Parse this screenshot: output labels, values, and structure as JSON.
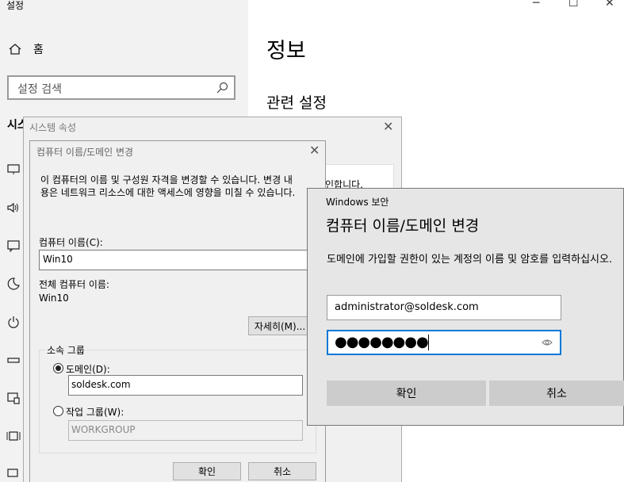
{
  "settings": {
    "window_title": "설정",
    "home_label": "홈",
    "search_placeholder": "설정 검색",
    "section_label": "시스",
    "page_title": "정보",
    "related_title": "관련 설정",
    "window_controls": [
      "─",
      "☐",
      "✕"
    ]
  },
  "system_properties": {
    "title": "시스템 속성",
    "close": "✕",
    "panel_text": "인합니다."
  },
  "computer_name_dialog": {
    "title": "컴퓨터 이름/도메인 변경",
    "close": "✕",
    "description_line1": "이 컴퓨터의 이름 및 구성원 자격을 변경할 수 있습니다. 변경 내",
    "description_line2": "용은 네트워크 리소스에 대한 액세스에 영향을 미칠 수 있습니다.",
    "computer_name_label": "컴퓨터 이름(C):",
    "computer_name_value": "Win10",
    "full_name_label": "전체 컴퓨터 이름:",
    "full_name_value": "Win10",
    "details_button": "자세히(M)...",
    "member_of_label": "소속 그룹",
    "domain_label": "도메인(D):",
    "domain_value": "soldesk.com",
    "workgroup_label": "작업 그룹(W):",
    "workgroup_value": "WORKGROUP",
    "ok_button": "확인",
    "cancel_button": "취소"
  },
  "windows_security": {
    "header": "Windows 보안",
    "title": "컴퓨터 이름/도메인 변경",
    "description": "도메인에 가입할 권한이 있는 계정의 이름 및 암호를 입력하십시오.",
    "username_value": "administrator@soldesk.com",
    "password_mask": "●●●●●●●●",
    "ok_button": "확인",
    "cancel_button": "취소"
  }
}
